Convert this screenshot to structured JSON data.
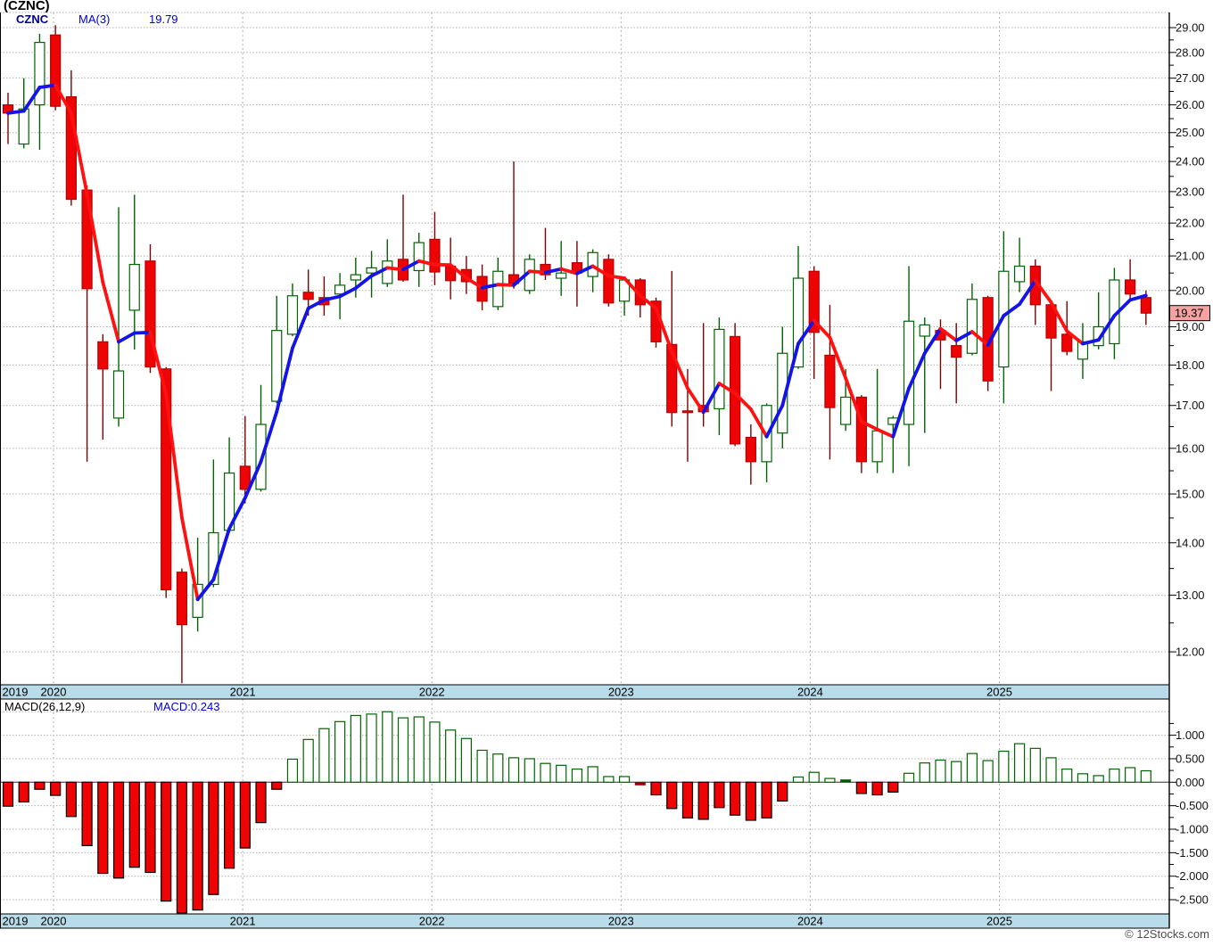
{
  "window": {
    "title": "(CZNC)"
  },
  "price_panel": {
    "legend": {
      "symbol": "CZNC",
      "ma_label": "MA(3)",
      "ma_value": "19.79"
    },
    "last_price_label": "19.37"
  },
  "macd_panel": {
    "legend_label": "MACD(26,12,9)",
    "legend_value": "MACD:0.243"
  },
  "watermark": "© 12Stocks.com",
  "colors": {
    "candle_down_fill": "#ee0404",
    "candle_down_edge": "#b30000",
    "candle_up_edge": "#006400",
    "candle_up_fill": "#ffffff",
    "wick_down": "#7a0202",
    "wick_up": "#056005",
    "ma_up": "#1414e6",
    "ma_down": "#ff1111",
    "grid": "#b0b0b0",
    "band_fill": "#b9dcea",
    "marker_fill": "#f7a2a2",
    "bar_neg_fill": "#ee0404",
    "bar_neg_edge": "#000000",
    "bar_pos_edge": "#006400",
    "bar_pos_fill": "#ffffff",
    "axis_text": "#111111"
  },
  "chart_data": [
    {
      "type": "candlestick",
      "title": "CZNC monthly candlesticks with MA(3) overlay (blue rising / red falling)",
      "y_scale": "log",
      "ylim": [
        11.45,
        29.63
      ],
      "y_ticks": [
        29,
        28,
        27,
        26,
        25,
        24,
        23,
        22,
        21,
        20,
        19,
        18,
        17,
        16,
        15,
        14,
        13,
        12
      ],
      "x_years": [
        "2019",
        "2020",
        "2021",
        "2022",
        "2023",
        "2024",
        "2025"
      ],
      "ma_window": 3,
      "ma_last": 19.79,
      "last_close": 19.37,
      "candles_ohlc": [
        [
          26.0,
          26.45,
          24.6,
          25.7
        ],
        [
          24.6,
          27.0,
          24.45,
          25.85
        ],
        [
          26.0,
          28.75,
          24.4,
          28.4
        ],
        [
          28.7,
          29.1,
          25.8,
          25.95
        ],
        [
          26.3,
          27.3,
          22.55,
          22.75
        ],
        [
          23.05,
          23.2,
          15.7,
          20.05
        ],
        [
          18.6,
          18.8,
          16.2,
          17.9
        ],
        [
          16.7,
          22.5,
          16.5,
          17.85
        ],
        [
          19.45,
          22.9,
          18.4,
          20.75
        ],
        [
          20.85,
          21.35,
          17.8,
          17.95
        ],
        [
          17.9,
          17.95,
          12.95,
          13.1
        ],
        [
          13.43,
          13.5,
          11.48,
          12.47
        ],
        [
          12.6,
          14.1,
          12.35,
          13.2
        ],
        [
          13.2,
          15.75,
          13.15,
          14.2
        ],
        [
          14.25,
          16.25,
          14.2,
          15.45
        ],
        [
          15.6,
          16.75,
          14.8,
          15.1
        ],
        [
          15.1,
          17.5,
          15.05,
          16.55
        ],
        [
          17.1,
          19.85,
          17.05,
          18.9
        ],
        [
          18.8,
          20.2,
          18.75,
          19.85
        ],
        [
          19.95,
          20.6,
          19.3,
          19.75
        ],
        [
          19.8,
          20.4,
          19.3,
          19.6
        ],
        [
          19.9,
          20.5,
          19.2,
          20.15
        ],
        [
          20.3,
          20.95,
          19.8,
          20.45
        ],
        [
          20.5,
          21.15,
          19.8,
          20.65
        ],
        [
          20.2,
          21.5,
          20.1,
          20.85
        ],
        [
          20.9,
          22.9,
          20.25,
          20.3
        ],
        [
          20.57,
          21.7,
          20.1,
          21.4
        ],
        [
          21.5,
          22.35,
          20.15,
          20.53
        ],
        [
          20.7,
          21.55,
          19.75,
          20.28
        ],
        [
          20.6,
          21.0,
          19.9,
          20.25
        ],
        [
          20.4,
          20.75,
          19.45,
          19.7
        ],
        [
          19.55,
          20.95,
          19.45,
          20.55
        ],
        [
          20.45,
          24.0,
          20.05,
          20.2
        ],
        [
          20.0,
          21.05,
          19.9,
          20.9
        ],
        [
          20.75,
          21.85,
          20.3,
          20.45
        ],
        [
          20.35,
          21.45,
          19.85,
          20.5
        ],
        [
          20.8,
          21.45,
          19.55,
          20.5
        ],
        [
          20.4,
          21.2,
          19.95,
          21.1
        ],
        [
          20.9,
          21.05,
          19.55,
          19.65
        ],
        [
          19.7,
          20.4,
          19.3,
          20.3
        ],
        [
          20.3,
          20.35,
          19.25,
          19.6
        ],
        [
          19.7,
          19.8,
          18.45,
          18.6
        ],
        [
          18.53,
          20.56,
          16.5,
          16.83
        ],
        [
          16.87,
          17.9,
          15.7,
          16.83
        ],
        [
          17.0,
          19.1,
          16.5,
          16.85
        ],
        [
          16.92,
          19.25,
          16.3,
          18.93
        ],
        [
          18.74,
          19.1,
          16.05,
          16.1
        ],
        [
          16.25,
          16.55,
          15.2,
          15.7
        ],
        [
          15.7,
          17.05,
          15.25,
          17.0
        ],
        [
          16.35,
          19.0,
          16.0,
          18.3
        ],
        [
          17.95,
          21.3,
          17.9,
          20.35
        ],
        [
          20.55,
          20.7,
          17.65,
          18.85
        ],
        [
          18.25,
          19.6,
          15.75,
          16.95
        ],
        [
          16.55,
          17.9,
          16.4,
          17.2
        ],
        [
          17.2,
          17.25,
          15.45,
          15.7
        ],
        [
          15.7,
          17.9,
          15.45,
          16.4
        ],
        [
          16.55,
          16.75,
          15.45,
          16.7
        ],
        [
          16.55,
          20.7,
          15.6,
          19.15
        ],
        [
          18.75,
          19.25,
          16.35,
          19.05
        ],
        [
          18.9,
          19.2,
          17.4,
          18.65
        ],
        [
          18.5,
          19.1,
          17.05,
          18.2
        ],
        [
          18.3,
          20.2,
          18.25,
          19.75
        ],
        [
          19.8,
          19.85,
          17.35,
          17.6
        ],
        [
          17.95,
          21.75,
          17.05,
          20.55
        ],
        [
          20.25,
          21.55,
          19.95,
          20.7
        ],
        [
          20.7,
          20.9,
          19.05,
          19.6
        ],
        [
          19.6,
          19.65,
          17.35,
          18.7
        ],
        [
          18.8,
          19.7,
          18.25,
          18.35
        ],
        [
          18.15,
          19.1,
          17.65,
          18.6
        ],
        [
          18.5,
          19.95,
          18.4,
          19.0
        ],
        [
          18.55,
          20.65,
          18.15,
          20.3
        ],
        [
          20.3,
          20.9,
          19.7,
          19.9
        ],
        [
          19.8,
          20.0,
          19.05,
          19.37
        ]
      ]
    },
    {
      "type": "bar",
      "title": "MACD(26,12,9) histogram",
      "last_value": 0.243,
      "y_ticks": [
        1.0,
        0.5,
        0.0,
        -0.5,
        -1.0,
        -1.5,
        -2.0,
        -2.5
      ],
      "values": [
        -0.51,
        -0.42,
        -0.15,
        -0.28,
        -0.73,
        -1.35,
        -1.94,
        -2.04,
        -1.81,
        -1.92,
        -2.53,
        -2.78,
        -2.72,
        -2.39,
        -1.83,
        -1.4,
        -0.86,
        -0.15,
        0.49,
        0.91,
        1.14,
        1.29,
        1.42,
        1.45,
        1.5,
        1.37,
        1.39,
        1.28,
        1.11,
        0.93,
        0.68,
        0.6,
        0.52,
        0.5,
        0.4,
        0.36,
        0.28,
        0.33,
        0.12,
        0.12,
        -0.02,
        -0.27,
        -0.56,
        -0.76,
        -0.79,
        -0.54,
        -0.7,
        -0.81,
        -0.76,
        -0.4,
        0.11,
        0.21,
        0.08,
        0.01,
        -0.24,
        -0.27,
        -0.21,
        0.19,
        0.41,
        0.47,
        0.44,
        0.61,
        0.46,
        0.66,
        0.82,
        0.72,
        0.52,
        0.28,
        0.18,
        0.14,
        0.28,
        0.31,
        0.243
      ]
    }
  ]
}
